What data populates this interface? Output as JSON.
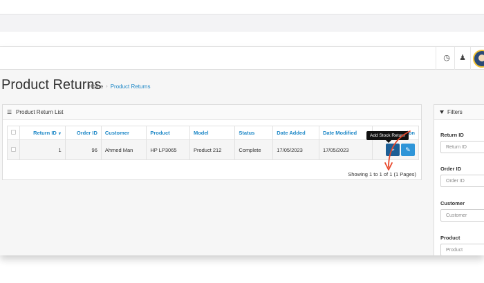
{
  "page": {
    "title": "Product Returns",
    "breadcrumb": {
      "home": "Home",
      "separator": "›",
      "current": "Product Returns"
    }
  },
  "panel": {
    "title": "Product Return List",
    "icon": "list-icon"
  },
  "table": {
    "headers": [
      "",
      "Return ID",
      "Order ID",
      "Customer",
      "Product",
      "Model",
      "Status",
      "Date Added",
      "Date Modified",
      "Action"
    ],
    "sorted_by": "Return ID",
    "rows": [
      {
        "return_id": "1",
        "order_id": "96",
        "customer": "Ahmed Man",
        "product": "HP LP3065",
        "model": "Product 212",
        "status": "Complete",
        "date_added": "17/05/2023",
        "date_modified": "17/05/2023"
      }
    ]
  },
  "tooltip": "Add Stock Return",
  "pagination": {
    "showing": "Showing 1 to 1 of 1 (1 Pages)"
  },
  "filters": {
    "title": "Filters",
    "fields": [
      {
        "label": "Return ID",
        "placeholder": "Return ID"
      },
      {
        "label": "Order ID",
        "placeholder": "Order ID"
      },
      {
        "label": "Customer",
        "placeholder": "Customer"
      },
      {
        "label": "Product",
        "placeholder": "Product"
      }
    ]
  },
  "colors": {
    "accent": "#1e88c7",
    "button_dark": "#1d5f96",
    "button_blue": "#2e95d8",
    "annotation_arrow": "#e8472a"
  }
}
